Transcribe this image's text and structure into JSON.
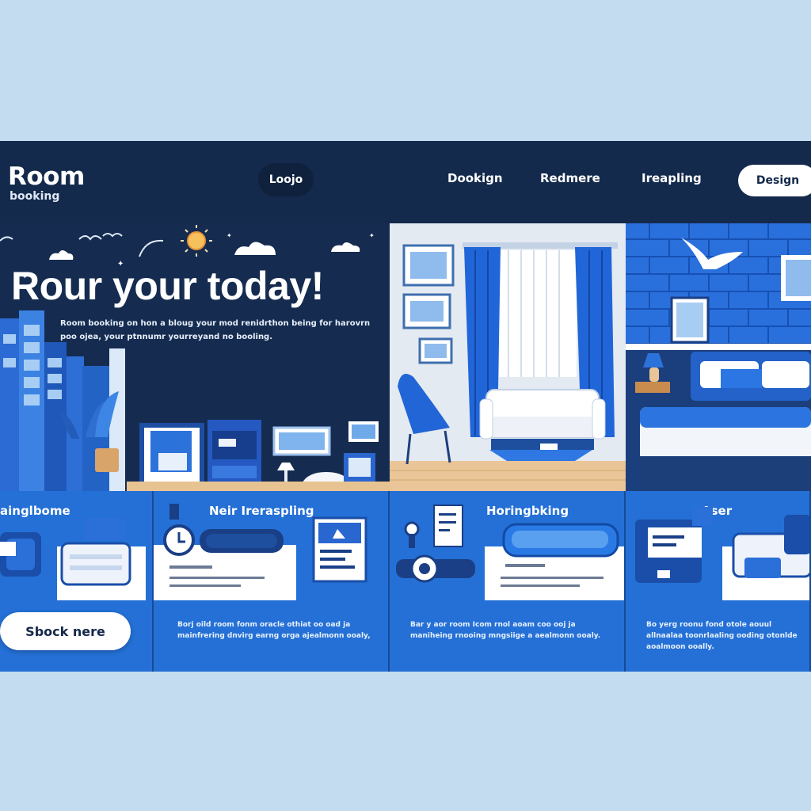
{
  "colors": {
    "background": "#c3dcef",
    "nav": "#142a4c",
    "accent": "#2470d6",
    "accent_dark": "#174a96",
    "button_bg": "#ffffff"
  },
  "brand": {
    "name": "Room",
    "sub": "booking"
  },
  "nav": {
    "pill_label": "Loojo",
    "links": [
      "Dookign",
      "Redmere",
      "Ireapling"
    ],
    "button_label": "Design"
  },
  "hero": {
    "title": "Rour your today!",
    "description": "Room booking on hon a bloug your mod renidrthon being for harovrn poo ojea, your ptnnumr yourreyand no booling."
  },
  "cards": [
    {
      "title": "ainglbome",
      "info": ""
    },
    {
      "title": "Neir Ireraspling",
      "info": "Borj oild room fonm oracle othiat oo oad ja mainfrering dnvirg earng orga ajealmonn ooaly,"
    },
    {
      "title": "Horingbking",
      "info": "Bar y aor room Icom rnol aoam coo ooj ja maniheing rnooing mngsiige a aealmonn ooaly."
    },
    {
      "title": "Aser",
      "info": "Bo yerg roonu fond otole aouul allnaalaa toonrlaaling ooding otonlde aoalmoon ooally."
    }
  ],
  "cta_label": "Sbock nere",
  "icons": [
    "sun-icon",
    "cloud-icon",
    "bird-icon",
    "bed-icon",
    "suitcase-icon",
    "clock-icon",
    "calendar-icon",
    "pillow-icon",
    "key-icon",
    "lamp-icon",
    "chair-icon",
    "sofa-icon",
    "plant-icon",
    "door-icon",
    "desk-icon",
    "map-icon",
    "credit-card-icon",
    "mirror-icon"
  ]
}
